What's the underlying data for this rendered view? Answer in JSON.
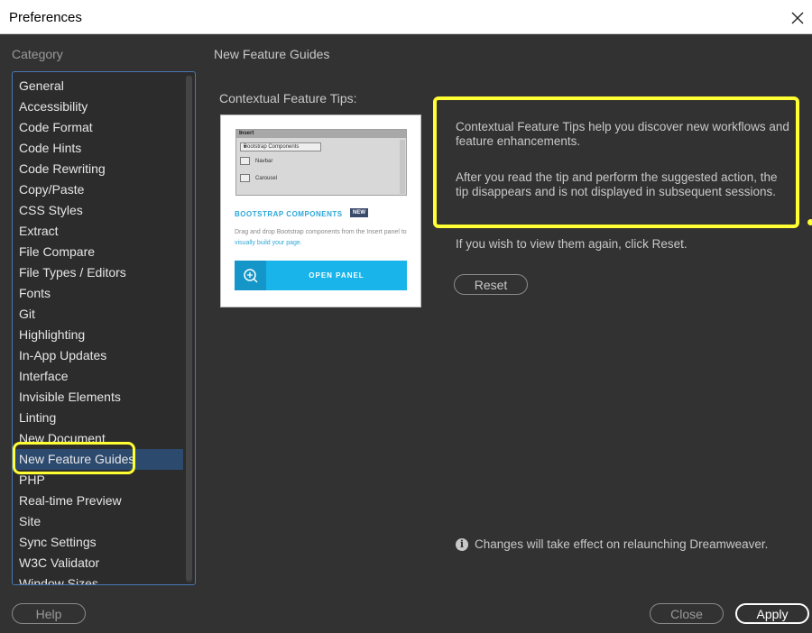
{
  "window": {
    "title": "Preferences"
  },
  "sidebar": {
    "label": "Category",
    "items": [
      {
        "label": "General"
      },
      {
        "label": "Accessibility"
      },
      {
        "label": "Code Format"
      },
      {
        "label": "Code Hints"
      },
      {
        "label": "Code Rewriting"
      },
      {
        "label": "Copy/Paste"
      },
      {
        "label": "CSS Styles"
      },
      {
        "label": "Extract"
      },
      {
        "label": "File Compare"
      },
      {
        "label": "File Types / Editors"
      },
      {
        "label": "Fonts"
      },
      {
        "label": "Git"
      },
      {
        "label": "Highlighting"
      },
      {
        "label": "In-App Updates"
      },
      {
        "label": "Interface"
      },
      {
        "label": "Invisible Elements"
      },
      {
        "label": "Linting"
      },
      {
        "label": "New Document"
      },
      {
        "label": "New Feature Guides",
        "selected": true
      },
      {
        "label": "PHP"
      },
      {
        "label": "Real-time Preview"
      },
      {
        "label": "Site"
      },
      {
        "label": "Sync Settings"
      },
      {
        "label": "W3C Validator"
      },
      {
        "label": "Window Sizes"
      }
    ]
  },
  "main": {
    "section_title": "New Feature Guides",
    "tips_label": "Contextual Feature Tips:",
    "preview": {
      "panel_title": "Insert",
      "select_value": "Bootstrap Components",
      "rows": [
        "Navbar",
        "Carousel"
      ],
      "heading": "BOOTSTRAP COMPONENTS",
      "badge": "NEW",
      "desc_a": "Drag and drop Bootstrap components from the Insert panel to ",
      "desc_link": "visually build your page.",
      "button": "OPEN PANEL"
    },
    "info_p1": "Contextual Feature Tips help you discover new workflows and feature enhancements.",
    "info_p2": "After you read the tip and perform the suggested action, the tip disappears and is not displayed in subsequent sessions.",
    "reset_note": "If you wish to view them again, click Reset.",
    "reset_label": "Reset",
    "relaunch_note": "Changes will take effect on relaunching Dreamweaver."
  },
  "footer": {
    "help": "Help",
    "close": "Close",
    "apply": "Apply"
  },
  "colors": {
    "highlight": "#ffff33",
    "selection": "#2c4a6e",
    "accent": "#19b4ea"
  }
}
